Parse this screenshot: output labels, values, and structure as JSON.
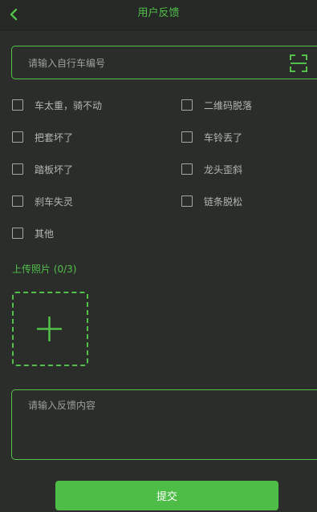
{
  "header": {
    "title": "用户反馈",
    "back_icon": "chevron-left-icon"
  },
  "bike_input": {
    "value": "",
    "placeholder": "请输入自行车编号",
    "scan_icon": "scan-icon"
  },
  "issues": [
    {
      "label": "车太重，骑不动",
      "checked": false
    },
    {
      "label": "二维码脱落",
      "checked": false
    },
    {
      "label": "把套坏了",
      "checked": false
    },
    {
      "label": "车铃丢了",
      "checked": false
    },
    {
      "label": "踏板坏了",
      "checked": false
    },
    {
      "label": "龙头歪斜",
      "checked": false
    },
    {
      "label": "刹车失灵",
      "checked": false
    },
    {
      "label": "链条脱松",
      "checked": false
    },
    {
      "label": "其他",
      "checked": false
    }
  ],
  "upload": {
    "title": "上传照片 (0/3)",
    "add_icon": "plus-icon"
  },
  "feedback": {
    "value": "",
    "placeholder": "请输入反馈内容"
  },
  "submit": {
    "label": "提交"
  },
  "colors": {
    "accent": "#52c04a",
    "background": "#2b2d2b",
    "button": "#4dbd47"
  }
}
